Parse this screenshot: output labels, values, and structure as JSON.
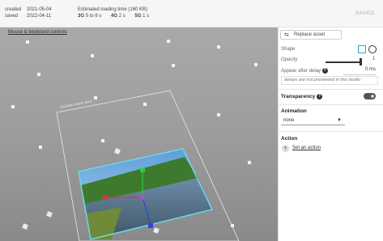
{
  "meta": {
    "created_label": "created",
    "created_value": "2021-05-04",
    "saved_label": "saved",
    "saved_value": "2022-04-11"
  },
  "loading": {
    "title": "Estimated loading time (160 KB)",
    "speeds": [
      {
        "net": "3G",
        "time": "5 to 6 s"
      },
      {
        "net": "4G",
        "time": "2 s"
      },
      {
        "net": "5G",
        "time": "1 s"
      }
    ]
  },
  "status": "SAVED",
  "viewport": {
    "controls_link": "Mouse & keyboard controls",
    "area_label": "Activate scene area"
  },
  "panel": {
    "replace_label": "Replace asset",
    "shape_label": "Shape",
    "opacity_label": "Opacity",
    "opacity_value": "1",
    "delay_label": "Appear after delay",
    "delay_value": "0 ms",
    "delay_note": "delays are not previewed in the studio",
    "transparency_label": "Transparency",
    "animation_label": "Animation",
    "animation_value": "none",
    "action_label": "Action",
    "set_action_label": "Set an action"
  },
  "colors": {
    "accent": "#28a8e0",
    "photo_frame": "#6fd7e8"
  },
  "icons": [
    "replace-icon",
    "square-shape-icon",
    "circle-shape-icon",
    "help-icon",
    "dropdown-caret-icon",
    "add-action-icon"
  ]
}
